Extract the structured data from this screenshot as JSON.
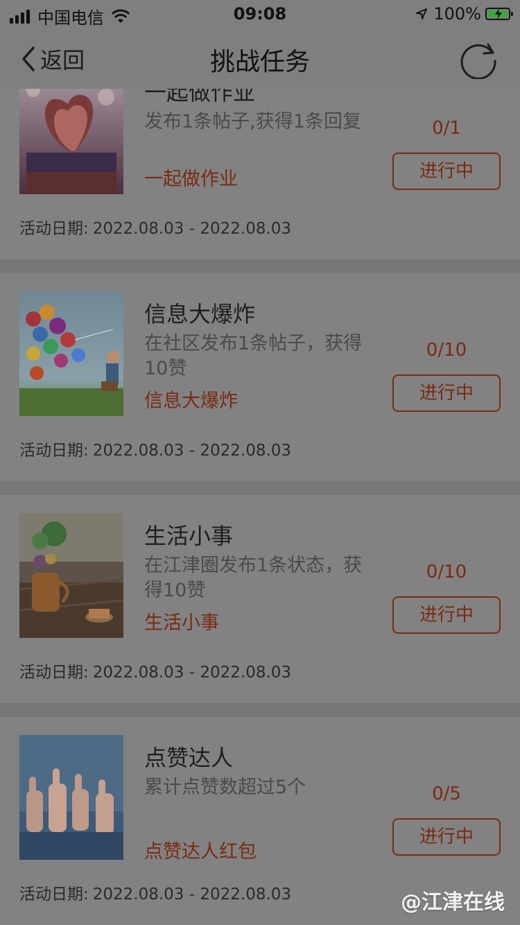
{
  "status_bar": {
    "carrier": "中国电信",
    "time": "09:08",
    "battery": "100%"
  },
  "nav": {
    "back_label": "返回",
    "title": "挑战任务"
  },
  "tasks": [
    {
      "title": "一起做作业",
      "desc": "发布1条帖子,获得1条回复",
      "tag": "一起做作业",
      "progress": "0/1",
      "status": "进行中",
      "date_label": "活动日期:",
      "date_range": "2022.08.03 - 2022.08.03",
      "image": "heart-book-photo"
    },
    {
      "title": "信息大爆炸",
      "desc": "在社区发布1条帖子，获得10赞",
      "tag": "信息大爆炸",
      "progress": "0/10",
      "status": "进行中",
      "date_label": "活动日期:",
      "date_range": "2022.08.03 - 2022.08.03",
      "image": "balloons-photo"
    },
    {
      "title": "生活小事",
      "desc": "在江津圈发布1条状态，获得10赞",
      "tag": "生活小事",
      "progress": "0/10",
      "status": "进行中",
      "date_label": "活动日期:",
      "date_range": "2022.08.03 - 2022.08.03",
      "image": "teapot-table-photo"
    },
    {
      "title": "点赞达人",
      "desc": "累计点赞数超过5个",
      "tag": "点赞达人红包",
      "progress": "0/5",
      "status": "进行中",
      "date_label": "活动日期:",
      "date_range": "2022.08.03 - 2022.08.03",
      "image": "thumbs-up-photo"
    }
  ],
  "watermark": "@江津在线",
  "icons": {
    "back": "chevron-left-icon",
    "refresh": "refresh-icon",
    "wifi": "wifi-icon",
    "location": "location-arrow-icon",
    "battery": "battery-charging-icon"
  },
  "colors": {
    "accent": "#7a2a12",
    "overlay": "#7f7f7f"
  }
}
